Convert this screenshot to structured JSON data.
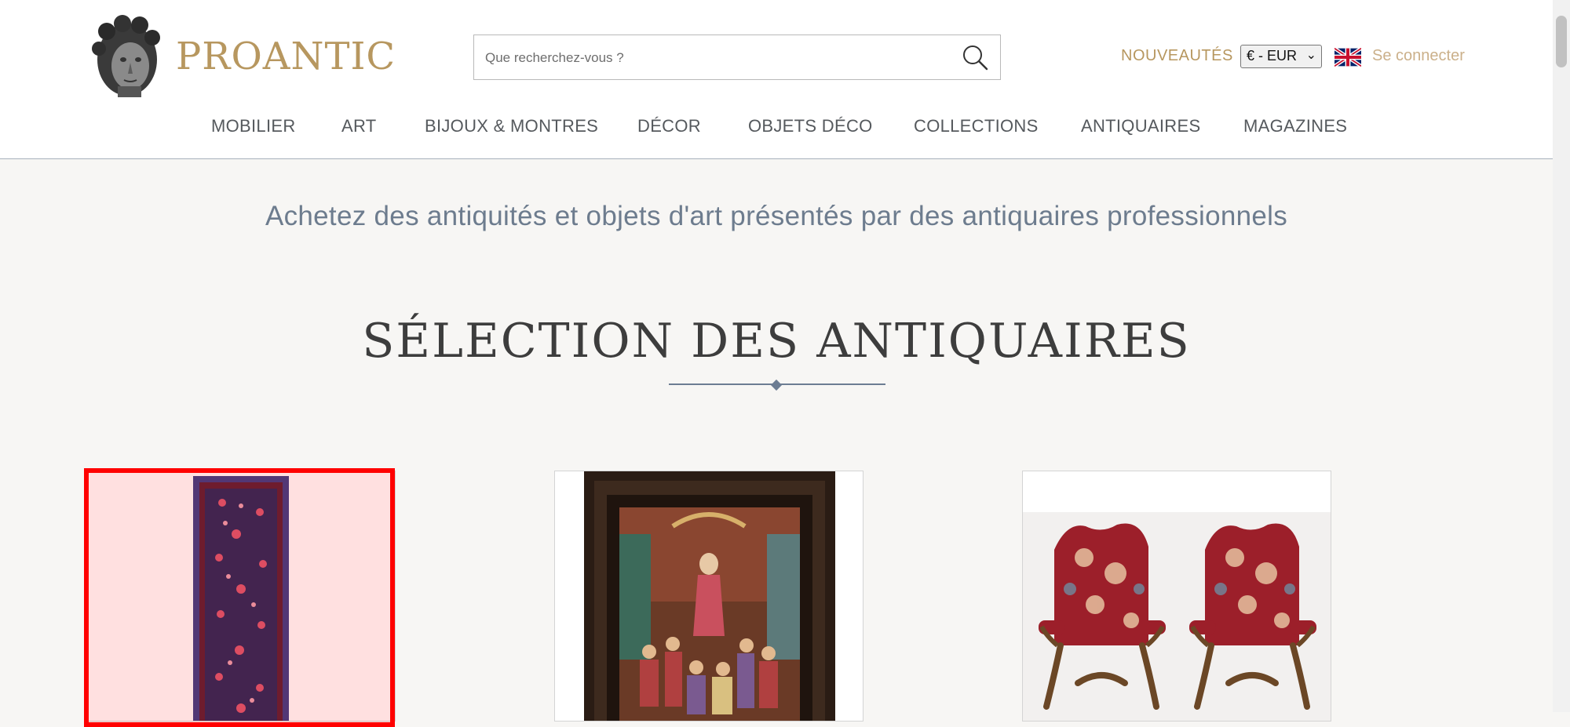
{
  "brand": {
    "name": "PROANTIC",
    "logo_icon": "statue-head-logo"
  },
  "search": {
    "placeholder": "Que recherchez-vous ?",
    "icon": "search-icon"
  },
  "header_links": {
    "news": "NOUVEAUTÉS",
    "currency": "€ - EUR",
    "language_flag": "uk-flag-icon",
    "login": "Se connecter"
  },
  "nav": {
    "items": [
      "MOBILIER",
      "ART",
      "BIJOUX & MONTRES",
      "DÉCOR",
      "OBJETS DÉCO",
      "COLLECTIONS",
      "ANTIQUAIRES",
      "MAGAZINES"
    ]
  },
  "tagline": "Achetez des antiquités et objets d'art présentés par des antiquaires professionnels",
  "section": {
    "title": "SÉLECTION DES ANTIQUAIRES"
  },
  "products": [
    {
      "image": "persian-runner-rug",
      "highlighted": true
    },
    {
      "image": "framed-allegorical-painting",
      "highlighted": false
    },
    {
      "image": "pair-of-upholstered-armchairs",
      "highlighted": false
    }
  ],
  "colors": {
    "brand_gold": "#b7975f",
    "login_gold": "#cbb08a",
    "tagline_blue": "#6d7c8e",
    "page_background": "#f7f6f4",
    "highlight_red": "#ff0000"
  }
}
